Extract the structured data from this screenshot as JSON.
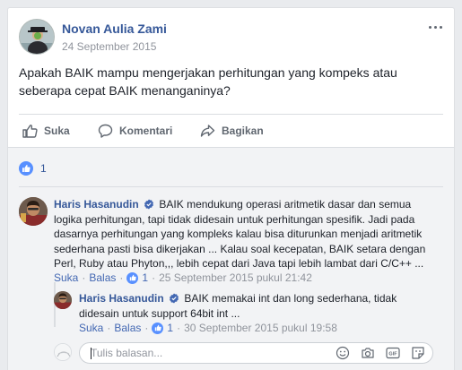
{
  "post": {
    "author": "Novan Aulia Zami",
    "date": "24 September 2015",
    "text_line1": "Apakah BAIK mampu mengerjakan perhitungan yang kompeks atau",
    "text_line2": "seberapa cepat BAIK menanganinya?"
  },
  "actions": {
    "like": "Suka",
    "comment": "Komentari",
    "share": "Bagikan"
  },
  "reactions": {
    "count": "1"
  },
  "comments": [
    {
      "author": "Haris Hasanudin",
      "text": "BAIK mendukung operasi aritmetik dasar dan semua logika perhitungan, tapi tidak didesain untuk perhitungan spesifik. Jadi pada dasarnya perhitungan yang kompleks kalau bisa diturunkan menjadi aritmetik sederhana pasti bisa dikerjakan ... Kalau soal kecepatan, BAIK setara dengan Perl, Ruby atau Phyton,,, lebih cepat dari Java tapi lebih lambat dari C/C++ ...",
      "like": "Suka",
      "reply": "Balas",
      "likes": "1",
      "date": "25 September 2015 pukul 21:42"
    }
  ],
  "reply": {
    "author": "Haris Hasanudin",
    "text": "BAIK memakai int dan long sederhana, tidak didesain untuk support 64bit int ...",
    "like": "Suka",
    "reply": "Balas",
    "likes": "1",
    "date": "30 September 2015 pukul 19:58"
  },
  "reply_box": {
    "placeholder": "Tulis balasan..."
  },
  "colors": {
    "link": "#365899",
    "accent": "#4267b2",
    "like_badge": "#5890ff",
    "meta": "#90949c"
  },
  "icons": [
    "more-icon",
    "like-icon",
    "comment-icon",
    "share-icon",
    "verified-icon",
    "emoji-icon",
    "camera-icon",
    "gif-icon",
    "sticker-icon"
  ]
}
